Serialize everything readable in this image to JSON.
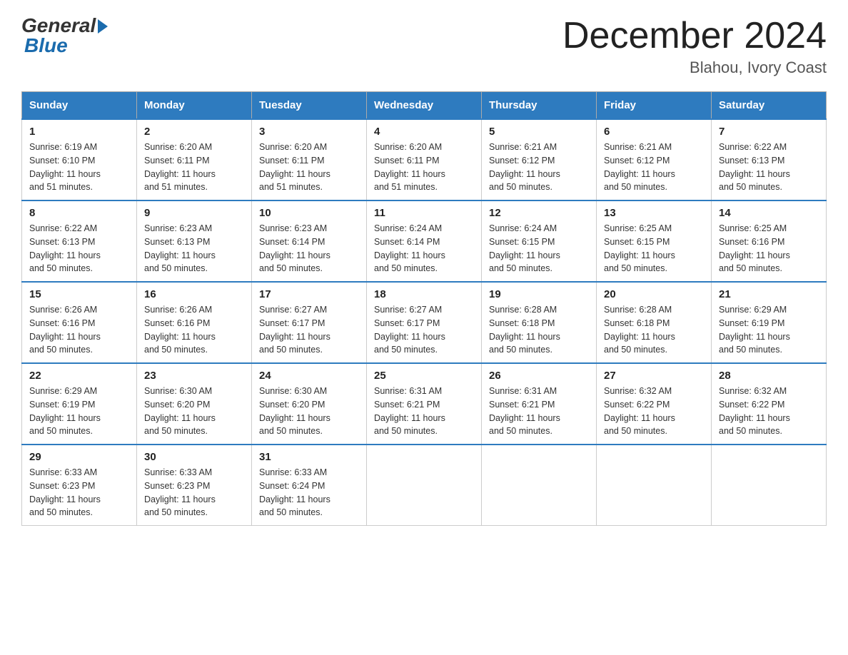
{
  "header": {
    "logo_general": "General",
    "logo_blue": "Blue",
    "month_title": "December 2024",
    "location": "Blahou, Ivory Coast"
  },
  "days_of_week": [
    "Sunday",
    "Monday",
    "Tuesday",
    "Wednesday",
    "Thursday",
    "Friday",
    "Saturday"
  ],
  "weeks": [
    [
      {
        "day": "1",
        "sunrise": "6:19 AM",
        "sunset": "6:10 PM",
        "daylight": "11 hours and 51 minutes."
      },
      {
        "day": "2",
        "sunrise": "6:20 AM",
        "sunset": "6:11 PM",
        "daylight": "11 hours and 51 minutes."
      },
      {
        "day": "3",
        "sunrise": "6:20 AM",
        "sunset": "6:11 PM",
        "daylight": "11 hours and 51 minutes."
      },
      {
        "day": "4",
        "sunrise": "6:20 AM",
        "sunset": "6:11 PM",
        "daylight": "11 hours and 51 minutes."
      },
      {
        "day": "5",
        "sunrise": "6:21 AM",
        "sunset": "6:12 PM",
        "daylight": "11 hours and 50 minutes."
      },
      {
        "day": "6",
        "sunrise": "6:21 AM",
        "sunset": "6:12 PM",
        "daylight": "11 hours and 50 minutes."
      },
      {
        "day": "7",
        "sunrise": "6:22 AM",
        "sunset": "6:13 PM",
        "daylight": "11 hours and 50 minutes."
      }
    ],
    [
      {
        "day": "8",
        "sunrise": "6:22 AM",
        "sunset": "6:13 PM",
        "daylight": "11 hours and 50 minutes."
      },
      {
        "day": "9",
        "sunrise": "6:23 AM",
        "sunset": "6:13 PM",
        "daylight": "11 hours and 50 minutes."
      },
      {
        "day": "10",
        "sunrise": "6:23 AM",
        "sunset": "6:14 PM",
        "daylight": "11 hours and 50 minutes."
      },
      {
        "day": "11",
        "sunrise": "6:24 AM",
        "sunset": "6:14 PM",
        "daylight": "11 hours and 50 minutes."
      },
      {
        "day": "12",
        "sunrise": "6:24 AM",
        "sunset": "6:15 PM",
        "daylight": "11 hours and 50 minutes."
      },
      {
        "day": "13",
        "sunrise": "6:25 AM",
        "sunset": "6:15 PM",
        "daylight": "11 hours and 50 minutes."
      },
      {
        "day": "14",
        "sunrise": "6:25 AM",
        "sunset": "6:16 PM",
        "daylight": "11 hours and 50 minutes."
      }
    ],
    [
      {
        "day": "15",
        "sunrise": "6:26 AM",
        "sunset": "6:16 PM",
        "daylight": "11 hours and 50 minutes."
      },
      {
        "day": "16",
        "sunrise": "6:26 AM",
        "sunset": "6:16 PM",
        "daylight": "11 hours and 50 minutes."
      },
      {
        "day": "17",
        "sunrise": "6:27 AM",
        "sunset": "6:17 PM",
        "daylight": "11 hours and 50 minutes."
      },
      {
        "day": "18",
        "sunrise": "6:27 AM",
        "sunset": "6:17 PM",
        "daylight": "11 hours and 50 minutes."
      },
      {
        "day": "19",
        "sunrise": "6:28 AM",
        "sunset": "6:18 PM",
        "daylight": "11 hours and 50 minutes."
      },
      {
        "day": "20",
        "sunrise": "6:28 AM",
        "sunset": "6:18 PM",
        "daylight": "11 hours and 50 minutes."
      },
      {
        "day": "21",
        "sunrise": "6:29 AM",
        "sunset": "6:19 PM",
        "daylight": "11 hours and 50 minutes."
      }
    ],
    [
      {
        "day": "22",
        "sunrise": "6:29 AM",
        "sunset": "6:19 PM",
        "daylight": "11 hours and 50 minutes."
      },
      {
        "day": "23",
        "sunrise": "6:30 AM",
        "sunset": "6:20 PM",
        "daylight": "11 hours and 50 minutes."
      },
      {
        "day": "24",
        "sunrise": "6:30 AM",
        "sunset": "6:20 PM",
        "daylight": "11 hours and 50 minutes."
      },
      {
        "day": "25",
        "sunrise": "6:31 AM",
        "sunset": "6:21 PM",
        "daylight": "11 hours and 50 minutes."
      },
      {
        "day": "26",
        "sunrise": "6:31 AM",
        "sunset": "6:21 PM",
        "daylight": "11 hours and 50 minutes."
      },
      {
        "day": "27",
        "sunrise": "6:32 AM",
        "sunset": "6:22 PM",
        "daylight": "11 hours and 50 minutes."
      },
      {
        "day": "28",
        "sunrise": "6:32 AM",
        "sunset": "6:22 PM",
        "daylight": "11 hours and 50 minutes."
      }
    ],
    [
      {
        "day": "29",
        "sunrise": "6:33 AM",
        "sunset": "6:23 PM",
        "daylight": "11 hours and 50 minutes."
      },
      {
        "day": "30",
        "sunrise": "6:33 AM",
        "sunset": "6:23 PM",
        "daylight": "11 hours and 50 minutes."
      },
      {
        "day": "31",
        "sunrise": "6:33 AM",
        "sunset": "6:24 PM",
        "daylight": "11 hours and 50 minutes."
      },
      null,
      null,
      null,
      null
    ]
  ],
  "labels": {
    "sunrise": "Sunrise:",
    "sunset": "Sunset:",
    "daylight": "Daylight:"
  }
}
